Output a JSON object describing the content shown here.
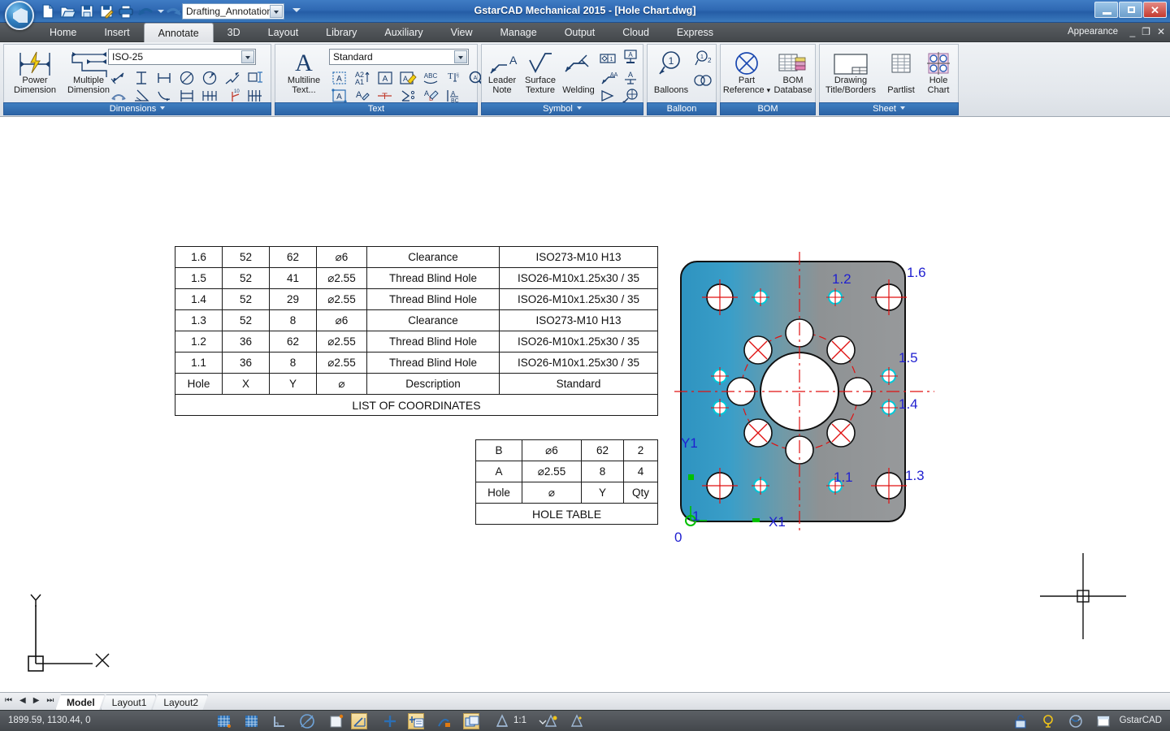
{
  "window": {
    "title": "GstarCAD Mechanical 2015 - [Hole Chart.dwg]",
    "minimize_label": "–",
    "restore_label": "❐",
    "close_label": "✕",
    "appearance_label": "Appearance",
    "mini_minimize": "_",
    "mini_restore": "❐",
    "mini_close": "✕"
  },
  "quick_access": {
    "doc_profile": "Drafting_Annotation",
    "buttons": [
      {
        "name": "new-file-icon",
        "tip": "New"
      },
      {
        "name": "open-file-icon",
        "tip": "Open"
      },
      {
        "name": "save-icon",
        "tip": "Save"
      },
      {
        "name": "save-as-icon",
        "tip": "Save As"
      },
      {
        "name": "print-icon",
        "tip": "Print"
      },
      {
        "name": "undo-icon",
        "tip": "Undo"
      },
      {
        "name": "redo-icon",
        "tip": "Redo"
      }
    ]
  },
  "ribbon": {
    "tabs": [
      {
        "label": "Home",
        "active": false
      },
      {
        "label": "Insert",
        "active": false
      },
      {
        "label": "Annotate",
        "active": true
      },
      {
        "label": "3D",
        "active": false
      },
      {
        "label": "Layout",
        "active": false
      },
      {
        "label": "Library",
        "active": false
      },
      {
        "label": "Auxiliary",
        "active": false
      },
      {
        "label": "View",
        "active": false
      },
      {
        "label": "Manage",
        "active": false
      },
      {
        "label": "Output",
        "active": false
      },
      {
        "label": "Cloud",
        "active": false
      },
      {
        "label": "Express",
        "active": false
      }
    ],
    "panels": {
      "dimensions": {
        "title": "Dimensions",
        "has_chevron": true,
        "style_combo": "ISO-25",
        "power_dimension": "Power\nDimension",
        "power_dimension_l1": "Power",
        "power_dimension_l2": "Dimension",
        "multiple_dimension_l1": "Multiple",
        "multiple_dimension_l2": "Dimension"
      },
      "text": {
        "title": "Text",
        "has_chevron": false,
        "style_combo": "Standard",
        "multiline_l1": "Multiline",
        "multiline_l2": "Text..."
      },
      "symbol": {
        "title": "Symbol",
        "has_chevron": true,
        "leader_note_l1": "Leader",
        "leader_note_l2": "Note",
        "surface_texture_l1": "Surface",
        "surface_texture_l2": "Texture",
        "welding": "Welding"
      },
      "balloon": {
        "title": "Balloon",
        "has_chevron": false,
        "balloons": "Balloons"
      },
      "bom": {
        "title": "BOM",
        "has_chevron": false,
        "part_reference_l1": "Part",
        "part_reference_l2": "Reference",
        "bom_database_l1": "BOM",
        "bom_database_l2": "Database"
      },
      "sheet": {
        "title": "Sheet",
        "has_chevron": true,
        "drawing_title_l1": "Drawing",
        "drawing_title_l2": "Title/Borders",
        "partlist": "Partlist",
        "hole_chart_l1": "Hole",
        "hole_chart_l2": "Chart"
      }
    }
  },
  "drawing": {
    "coordinates_table": {
      "caption": "LIST OF COORDINATES",
      "headers": [
        "Hole",
        "X",
        "Y",
        "⌀",
        "Description",
        "Standard"
      ],
      "rows": [
        [
          "1.6",
          "52",
          "62",
          "⌀6",
          "Clearance",
          "ISO273-M10 H13"
        ],
        [
          "1.5",
          "52",
          "41",
          "⌀2.55",
          "Thread Blind Hole",
          "ISO26-M10x1.25x30 / 35"
        ],
        [
          "1.4",
          "52",
          "29",
          "⌀2.55",
          "Thread Blind Hole",
          "ISO26-M10x1.25x30 / 35"
        ],
        [
          "1.3",
          "52",
          "8",
          "⌀6",
          "Clearance",
          "ISO273-M10 H13"
        ],
        [
          "1.2",
          "36",
          "62",
          "⌀2.55",
          "Thread Blind Hole",
          "ISO26-M10x1.25x30 / 35"
        ],
        [
          "1.1",
          "36",
          "8",
          "⌀2.55",
          "Thread Blind Hole",
          "ISO26-M10x1.25x30 / 35"
        ]
      ]
    },
    "hole_table": {
      "caption": "HOLE TABLE",
      "headers": [
        "Hole",
        "⌀",
        "Y",
        "Qty"
      ],
      "rows": [
        [
          "B",
          "⌀6",
          "62",
          "2"
        ],
        [
          "A",
          "⌀2.55",
          "8",
          "4"
        ]
      ]
    },
    "labels": {
      "hole_1_1": "1.1",
      "hole_1_2": "1.2",
      "hole_1_3": "1.3",
      "hole_1_4": "1.4",
      "hole_1_5": "1.5",
      "hole_1_6": "1.6",
      "axis_x": "X1",
      "axis_y": "Y1",
      "origin_zero": "0",
      "origin_one": "1"
    },
    "ucs": {
      "x_label": "X",
      "y_label": "Y"
    },
    "colors": {
      "label_blue": "#1f1fd0",
      "centerline_red": "#e01111",
      "hole_cyan": "#00c8d8",
      "part_blue": "#2a93bf",
      "part_gray": "#8c8c8c"
    }
  },
  "layout_bar": {
    "nav": [
      "⏮",
      "◀",
      "▶",
      "⏭"
    ],
    "tabs": [
      {
        "label": "Model",
        "active": true
      },
      {
        "label": "Layout1",
        "active": false
      },
      {
        "label": "Layout2",
        "active": false
      }
    ]
  },
  "status_bar": {
    "coordinates": "1899.59, 1130.44, 0",
    "scale": "1:1",
    "app_name": "GstarCAD",
    "left_icons": [
      {
        "name": "grid-snap-icon",
        "active": false
      },
      {
        "name": "grid-display-icon",
        "active": false
      },
      {
        "name": "ortho-icon",
        "active": false
      },
      {
        "name": "polar-tracking-icon",
        "active": false
      },
      {
        "name": "object-snap-icon",
        "active": false
      },
      {
        "name": "osnap-tracking-icon",
        "active": true
      },
      {
        "name": "dynamic-ucs-icon",
        "active": false
      },
      {
        "name": "dynamic-input-icon",
        "active": true
      },
      {
        "name": "lineweight-icon",
        "active": false
      },
      {
        "name": "transparency-icon",
        "active": true
      },
      {
        "name": "annotation-scale-icon",
        "active": false
      },
      {
        "name": "annotation-visibility-icon",
        "active": false
      },
      {
        "name": "auto-scale-icon",
        "active": false
      }
    ],
    "right_icons": [
      {
        "name": "lock-icon"
      },
      {
        "name": "lightbulb-icon"
      },
      {
        "name": "clean-screen-icon"
      },
      {
        "name": "window-icon"
      }
    ]
  }
}
